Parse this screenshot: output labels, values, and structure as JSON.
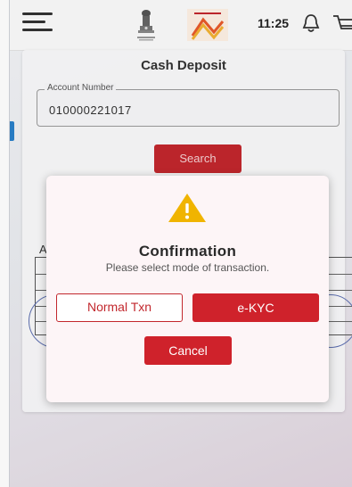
{
  "header": {
    "time": "11:25",
    "icons": [
      "menu-icon",
      "national-emblem-logo",
      "india-post-logo",
      "notification-bell-icon",
      "cart-icon"
    ]
  },
  "form": {
    "title": "Cash Deposit",
    "account_number_label": "Account Number",
    "account_number_value": "010000221017",
    "search_button": "Search",
    "section_label_partial": "Ac"
  },
  "dialog": {
    "icon": "warning-icon",
    "title": "Confirmation",
    "message": "Please select mode of transaction.",
    "buttons": {
      "normal_txn": "Normal Txn",
      "ekyc": "e-KYC",
      "cancel": "Cancel"
    }
  },
  "colors": {
    "accent_red": "#cf222b",
    "warning_yellow": "#f0b400",
    "dialog_bg": "#fdf5f7"
  }
}
